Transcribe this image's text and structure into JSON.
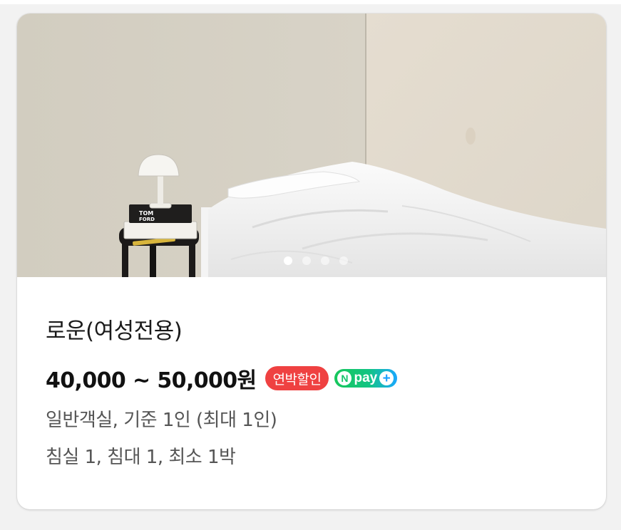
{
  "listing": {
    "name": "로운(여성전용)",
    "price": "40,000 ~ 50,000원",
    "badges": {
      "long_stay": "연박할인",
      "npay_n": "N",
      "npay_text": "pay",
      "npay_plus": "+"
    },
    "room_info": "일반객실, 기준 1인 (최대 1인)",
    "bed_info": "침실 1, 침대 1, 최소 1박"
  },
  "carousel": {
    "total_slides": 4,
    "active_index": 0,
    "photo_icon": "room-photo",
    "book_label_top": "TOM",
    "book_label_bottom": "FORD"
  },
  "colors": {
    "sale_badge": "#ef4141",
    "npay_green": "#14c46b",
    "npay_blue": "#1ea0ff",
    "wall": "#d9d4c8",
    "bedding": "#f2f2f2"
  }
}
